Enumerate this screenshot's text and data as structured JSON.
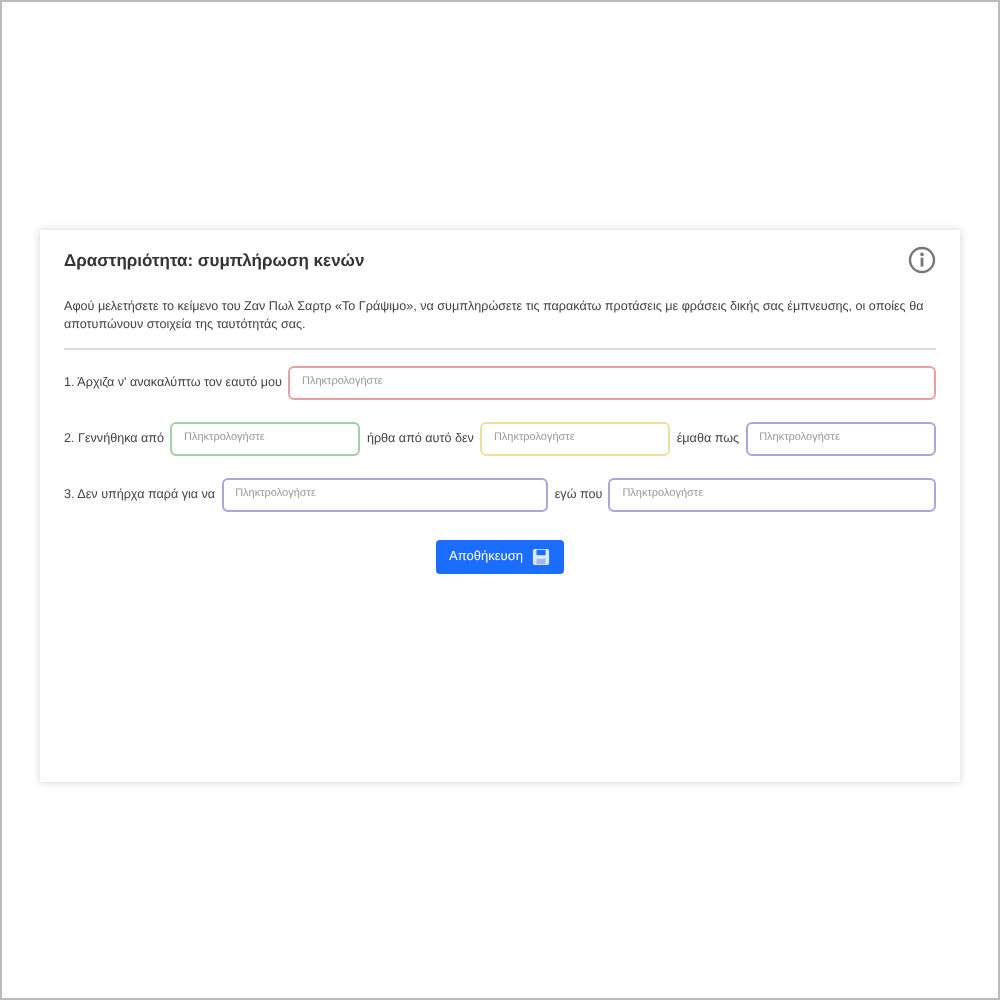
{
  "card": {
    "title": "Δραστηριότητα: συμπλήρωση κενών",
    "instructions": "Αφού μελετήσετε το κείμενο του Ζαν Πωλ Σαρτρ «Το Γράψιμο», να συμπληρώσετε τις παρακάτω προτάσεις με φράσεις δικής σας έμπνευσης, οι οποίες θα αποτυπώνουν στοιχεία της ταυτότητάς σας.",
    "rows": [
      {
        "parts": [
          {
            "kind": "text",
            "text": "1. Άρχιζα ν' ανακαλύπτω τον εαυτό μου"
          },
          {
            "kind": "blank",
            "placeholder": "Πληκτρολογήστε",
            "color": "#e8a0a4"
          }
        ]
      },
      {
        "parts": [
          {
            "kind": "text",
            "text": "2. Γεννήθηκα από"
          },
          {
            "kind": "blank",
            "placeholder": "Πληκτρολογήστε",
            "color": "#9fd0a6"
          },
          {
            "kind": "text",
            "text": "ήρθα από αυτό δεν"
          },
          {
            "kind": "blank",
            "placeholder": "Πληκτρολογήστε",
            "color": "#ece0a0"
          },
          {
            "kind": "text",
            "text": "έμαθα πως"
          },
          {
            "kind": "blank",
            "placeholder": "Πληκτρολογήστε",
            "color": "#a9a6e0"
          }
        ]
      },
      {
        "parts": [
          {
            "kind": "text",
            "text": "3. Δεν υπήρχα παρά για να"
          },
          {
            "kind": "blank",
            "placeholder": "Πληκτρολογήστε",
            "color": "#a9a6e0"
          },
          {
            "kind": "text",
            "text": "εγώ που"
          },
          {
            "kind": "blank",
            "placeholder": "Πληκτρολογήστε",
            "color": "#a9a6e0"
          }
        ]
      }
    ],
    "button": "Αποθήκευση"
  }
}
